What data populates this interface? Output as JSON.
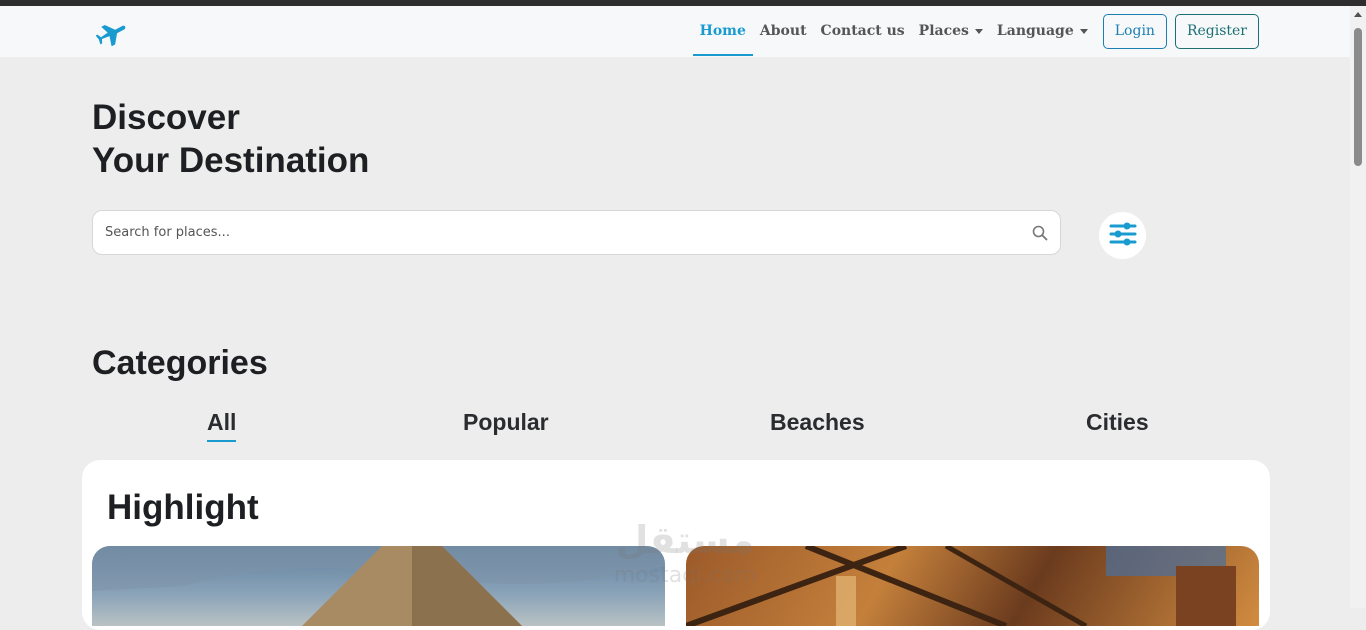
{
  "nav": {
    "links": [
      "Home",
      "About",
      "Contact us"
    ],
    "places": "Places",
    "language": "Language",
    "login": "Login",
    "register": "Register"
  },
  "hero": {
    "line1": "Discover",
    "line2": "Your Destination"
  },
  "search": {
    "placeholder": "Search for places..."
  },
  "categories": {
    "title": "Categories",
    "tabs": [
      "All",
      "Popular",
      "Beaches",
      "Cities"
    ]
  },
  "highlight": {
    "title": "Highlight"
  },
  "watermark": {
    "arabic": "مستقل",
    "latin": "mostaql.com"
  },
  "colors": {
    "accent": "#1a9bd0",
    "register_border": "#1b6f73",
    "background": "#ededed"
  },
  "icons": {
    "logo": "airplane-icon",
    "search": "search-icon",
    "filter": "sliders-icon"
  }
}
